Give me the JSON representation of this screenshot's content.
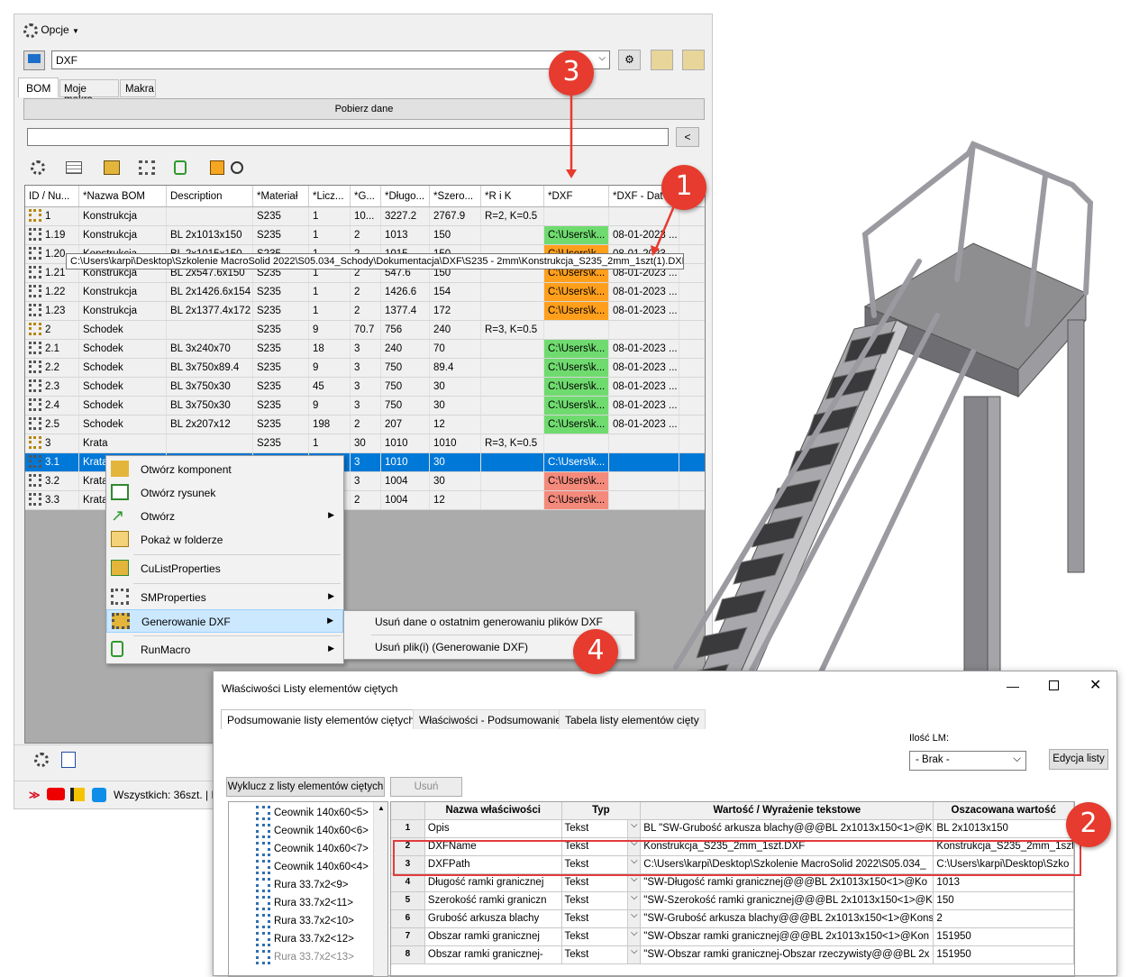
{
  "toolbar": {
    "options_label": "Opcje",
    "profile_value": "DXF"
  },
  "tabs": [
    "BOM",
    "Moje makra",
    "Makra"
  ],
  "fetch_button": "Pobierz dane",
  "search_button": "<",
  "columns": [
    "ID / Nu...",
    "*Nazwa BOM",
    "Description",
    "*Materiał",
    "*Licz...",
    "*G...",
    "*Długo...",
    "*Szero...",
    "*R i K",
    "*DXF",
    "*DXF - Dat"
  ],
  "rows": [
    {
      "id": "1",
      "name": "Konstrukcja",
      "desc": "",
      "mat": "S235",
      "qty": "1",
      "g": "10...",
      "len": "3227.2",
      "wid": "2767.9",
      "rk": "R=2, K=0.5",
      "dxf": "",
      "dxfc": "",
      "date": ""
    },
    {
      "id": "1.19",
      "name": "Konstrukcja",
      "desc": "BL 2x1013x150",
      "mat": "S235",
      "qty": "1",
      "g": "2",
      "len": "1013",
      "wid": "150",
      "rk": "",
      "dxf": "C:\\Users\\k...",
      "dxfc": "dxg",
      "date": "08-01-2023 ..."
    },
    {
      "id": "1.20",
      "name": "Konstrukcja",
      "desc": "BL 2x1015x150",
      "mat": "S235",
      "qty": "1",
      "g": "2",
      "len": "1015",
      "wid": "150",
      "rk": "",
      "dxf": "C:\\Users\\k...",
      "dxfc": "dxo",
      "date": "08-01-2023 ..."
    },
    {
      "id": "1.21",
      "name": "Konstrukcja",
      "desc": "BL 2x547.6x150",
      "mat": "S235",
      "qty": "1",
      "g": "2",
      "len": "547.6",
      "wid": "150",
      "rk": "",
      "dxf": "C:\\Users\\k...",
      "dxfc": "dxo",
      "date": "08-01-2023 ..."
    },
    {
      "id": "1.22",
      "name": "Konstrukcja",
      "desc": "BL 2x1426.6x154",
      "mat": "S235",
      "qty": "1",
      "g": "2",
      "len": "1426.6",
      "wid": "154",
      "rk": "",
      "dxf": "C:\\Users\\k...",
      "dxfc": "dxo",
      "date": "08-01-2023 ..."
    },
    {
      "id": "1.23",
      "name": "Konstrukcja",
      "desc": "BL 2x1377.4x172",
      "mat": "S235",
      "qty": "1",
      "g": "2",
      "len": "1377.4",
      "wid": "172",
      "rk": "",
      "dxf": "C:\\Users\\k...",
      "dxfc": "dxo",
      "date": "08-01-2023 ..."
    },
    {
      "id": "2",
      "name": "Schodek",
      "desc": "",
      "mat": "S235",
      "qty": "9",
      "g": "70.7",
      "len": "756",
      "wid": "240",
      "rk": "R=3, K=0.5",
      "dxf": "",
      "dxfc": "",
      "date": ""
    },
    {
      "id": "2.1",
      "name": "Schodek",
      "desc": "BL 3x240x70",
      "mat": "S235",
      "qty": "18",
      "g": "3",
      "len": "240",
      "wid": "70",
      "rk": "",
      "dxf": "C:\\Users\\k...",
      "dxfc": "dxg",
      "date": "08-01-2023 ..."
    },
    {
      "id": "2.2",
      "name": "Schodek",
      "desc": "BL 3x750x89.4",
      "mat": "S235",
      "qty": "9",
      "g": "3",
      "len": "750",
      "wid": "89.4",
      "rk": "",
      "dxf": "C:\\Users\\k...",
      "dxfc": "dxg",
      "date": "08-01-2023 ..."
    },
    {
      "id": "2.3",
      "name": "Schodek",
      "desc": "BL 3x750x30",
      "mat": "S235",
      "qty": "45",
      "g": "3",
      "len": "750",
      "wid": "30",
      "rk": "",
      "dxf": "C:\\Users\\k...",
      "dxfc": "dxg",
      "date": "08-01-2023 ..."
    },
    {
      "id": "2.4",
      "name": "Schodek",
      "desc": "BL 3x750x30",
      "mat": "S235",
      "qty": "9",
      "g": "3",
      "len": "750",
      "wid": "30",
      "rk": "",
      "dxf": "C:\\Users\\k...",
      "dxfc": "dxg",
      "date": "08-01-2023 ..."
    },
    {
      "id": "2.5",
      "name": "Schodek",
      "desc": "BL 2x207x12",
      "mat": "S235",
      "qty": "198",
      "g": "2",
      "len": "207",
      "wid": "12",
      "rk": "",
      "dxf": "C:\\Users\\k...",
      "dxfc": "dxg",
      "date": "08-01-2023 ..."
    },
    {
      "id": "3",
      "name": "Krata",
      "desc": "",
      "mat": "S235",
      "qty": "1",
      "g": "30",
      "len": "1010",
      "wid": "1010",
      "rk": "R=3, K=0.5",
      "dxf": "",
      "dxfc": "",
      "date": ""
    },
    {
      "id": "3.1",
      "name": "Krata",
      "desc": "",
      "mat": "",
      "qty": "",
      "g": "3",
      "len": "1010",
      "wid": "30",
      "rk": "",
      "dxf": "C:\\Users\\k...",
      "dxfc": "sel",
      "date": ""
    },
    {
      "id": "3.2",
      "name": "Krata",
      "desc": "",
      "mat": "",
      "qty": "",
      "g": "3",
      "len": "1004",
      "wid": "30",
      "rk": "",
      "dxf": "C:\\Users\\k...",
      "dxfc": "dxr",
      "date": ""
    },
    {
      "id": "3.3",
      "name": "Krata",
      "desc": "",
      "mat": "",
      "qty": "",
      "g": "2",
      "len": "1004",
      "wid": "12",
      "rk": "",
      "dxf": "C:\\Users\\k...",
      "dxfc": "dxr",
      "date": ""
    }
  ],
  "tooltip": "C:\\Users\\karpi\\Desktop\\Szkolenie MacroSolid 2022\\S05.034_Schody\\Dokumentacja\\DXF\\S235 - 2mm\\Konstrukcja_S235_2mm_1szt(1).DXF",
  "menu": {
    "items": [
      "Otwórz komponent",
      "Otwórz rysunek",
      "Otwórz",
      "Pokaż w folderze",
      "CuListProperties",
      "SMProperties",
      "Generowanie DXF",
      "RunMacro"
    ]
  },
  "submenu": [
    "Usuń dane o ostatnim generowaniu plików DXF",
    "Usuń plik(i) (Generowanie DXF)"
  ],
  "status": {
    "text": "Wszystkich: 36szt. | P"
  },
  "badges": [
    "3",
    "1",
    "4",
    "2"
  ],
  "dialog": {
    "title": "Właściwości Listy elementów ciętych",
    "tabs": [
      "Podsumowanie listy elementów ciętych",
      "Właściwości - Podsumowanie",
      "Tabela listy elementów cięty"
    ],
    "ilosc_label": "Ilość LM:",
    "ilosc_value": "- Brak -",
    "edit_button": "Edycja listy",
    "exclude_button": "Wyklucz z listy elementów ciętych",
    "remove_button": "Usuń",
    "tree": [
      "Ceownik 140x60<5>",
      "Ceownik 140x60<6>",
      "Ceownik 140x60<7>",
      "Ceownik 140x60<4>",
      "Rura 33.7x2<9>",
      "Rura 33.7x2<11>",
      "Rura 33.7x2<10>",
      "Rura 33.7x2<12>",
      "Rura 33.7x2<13>"
    ],
    "columns": [
      "",
      "Nazwa właściwości",
      "Typ",
      "Wartość / Wyrażenie tekstowe",
      "Oszacowana wartość"
    ],
    "rows": [
      {
        "n": "1",
        "name": "Opis",
        "type": "Tekst",
        "val": "BL \"SW-Grubość arkusza blachy@@@BL 2x1013x150<1>@K",
        "est": "BL 2x1013x150"
      },
      {
        "n": "2",
        "name": "DXFName",
        "type": "Tekst",
        "val": "Konstrukcja_S235_2mm_1szt.DXF",
        "est": "Konstrukcja_S235_2mm_1szt."
      },
      {
        "n": "3",
        "name": "DXFPath",
        "type": "Tekst",
        "val": "C:\\Users\\karpi\\Desktop\\Szkolenie MacroSolid 2022\\S05.034_",
        "est": "C:\\Users\\karpi\\Desktop\\Szko"
      },
      {
        "n": "4",
        "name": "Długość ramki granicznej",
        "type": "Tekst",
        "val": "\"SW-Długość ramki granicznej@@@BL 2x1013x150<1>@Ko",
        "est": "1013"
      },
      {
        "n": "5",
        "name": "Szerokość ramki graniczn",
        "type": "Tekst",
        "val": "\"SW-Szerokość ramki granicznej@@@BL 2x1013x150<1>@K",
        "est": "150"
      },
      {
        "n": "6",
        "name": "Grubość arkusza blachy",
        "type": "Tekst",
        "val": "\"SW-Grubość arkusza blachy@@@BL 2x1013x150<1>@Kons",
        "est": "2"
      },
      {
        "n": "7",
        "name": "Obszar ramki granicznej",
        "type": "Tekst",
        "val": "\"SW-Obszar ramki granicznej@@@BL 2x1013x150<1>@Kon",
        "est": "151950"
      },
      {
        "n": "8",
        "name": "Obszar ramki granicznej-",
        "type": "Tekst",
        "val": "\"SW-Obszar ramki granicznej-Obszar rzeczywisty@@@BL 2x",
        "est": "151950"
      }
    ]
  }
}
